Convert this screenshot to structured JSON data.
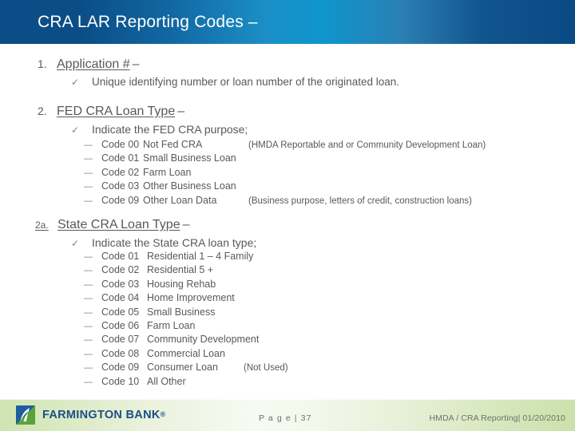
{
  "slide": {
    "title": "CRA LAR Reporting Codes –"
  },
  "sections": [
    {
      "number": "1.",
      "title": "Application #",
      "dash": "–",
      "bullet": {
        "icon": "checkmark-icon",
        "glyph": "✓",
        "text": "Unique identifying number or loan number of the originated loan."
      },
      "codes": []
    },
    {
      "number": "2.",
      "title": "FED CRA Loan Type",
      "dash": "–",
      "bullet": {
        "icon": "checkmark-icon",
        "glyph": "✓",
        "text": "Indicate the FED CRA purpose;"
      },
      "codes": [
        {
          "bullet": "—",
          "code": "Code 00",
          "label": "Not Fed CRA",
          "note": "(HMDA Reportable and or Community Development Loan)"
        },
        {
          "bullet": "—",
          "code": "Code 01",
          "label": "Small Business Loan",
          "note": ""
        },
        {
          "bullet": "—",
          "code": "Code 02",
          "label": "Farm Loan",
          "note": ""
        },
        {
          "bullet": "—",
          "code": "Code 03",
          "label": "Other Business Loan",
          "note": ""
        },
        {
          "bullet": "—",
          "code": "Code 09",
          "label": "Other Loan Data",
          "note": "(Business purpose, letters of credit, construction loans)"
        }
      ]
    },
    {
      "number": "2a.",
      "title": "State CRA Loan Type",
      "dash": "–",
      "bullet": {
        "icon": "checkmark-icon",
        "glyph": "✓",
        "text": "Indicate the State CRA loan type;"
      },
      "codes": [
        {
          "bullet": "—",
          "code": "Code 01",
          "label": "Residential 1 – 4 Family",
          "note": ""
        },
        {
          "bullet": "—",
          "code": "Code 02",
          "label": "Residential 5 +",
          "note": ""
        },
        {
          "bullet": "—",
          "code": "Code 03",
          "label": "Housing Rehab",
          "note": ""
        },
        {
          "bullet": "—",
          "code": "Code 04",
          "label": "Home Improvement",
          "note": ""
        },
        {
          "bullet": "—",
          "code": "Code 05",
          "label": "Small Business",
          "note": ""
        },
        {
          "bullet": "—",
          "code": "Code 06",
          "label": "Farm Loan",
          "note": ""
        },
        {
          "bullet": "—",
          "code": "Code 07",
          "label": "Community Development",
          "note": ""
        },
        {
          "bullet": "—",
          "code": "Code 08",
          "label": "Commercial Loan",
          "note": ""
        },
        {
          "bullet": "—",
          "code": "Code 09",
          "label": "Consumer Loan",
          "note": "(Not Used)"
        },
        {
          "bullet": "—",
          "code": "Code 10",
          "label": "All Other",
          "note": ""
        }
      ]
    }
  ],
  "footer": {
    "logo_icon": "farmington-bank-logo-icon",
    "logo_name": "FARMINGTON BANK",
    "logo_tm": "®",
    "page_label": "P a g e | 37",
    "right_text": "HMDA / CRA Reporting| 01/20/2010"
  },
  "colors": {
    "header_dark_blue": "#0b4d87",
    "header_bright_blue": "#0e96cd",
    "body_text": "#595959",
    "logo_blue": "#1b4f86",
    "logo_green": "#4f9a36",
    "footer_green": "#cfe4b1"
  }
}
